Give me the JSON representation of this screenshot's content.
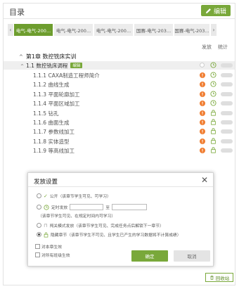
{
  "header": {
    "title": "目录",
    "edit_label": "编辑"
  },
  "tabs": {
    "prev": "‹",
    "next": "›",
    "items": [
      {
        "label": "电气-电气-200...",
        "active": true
      },
      {
        "label": "电气-电气-200...",
        "active": false
      },
      {
        "label": "电气-电气-200...",
        "active": false
      },
      {
        "label": "国赛-电气-203...",
        "active": false
      },
      {
        "label": "国赛-电气-203...",
        "active": false
      }
    ]
  },
  "columns": {
    "publish": "发放",
    "stats": "统计"
  },
  "chapter": {
    "caret": "^",
    "title": "第1章 数控铣床实训"
  },
  "section": {
    "caret": "^",
    "title": "1.1 数控铣床调程",
    "badge": "编辑"
  },
  "rows": [
    {
      "label": "1.1.1 CAXA制造工程师简介",
      "warn": true,
      "status": "clock"
    },
    {
      "label": "1.1.2 曲线生成",
      "warn": true,
      "status": "clock"
    },
    {
      "label": "1.1.3 平面轮廓加工",
      "warn": true,
      "status": "clock"
    },
    {
      "label": "1.1.4 平面区域加工",
      "warn": true,
      "status": "clock"
    },
    {
      "label": "1.1.5 钻孔",
      "warn": true,
      "status": "lock"
    },
    {
      "label": "1.1.6 曲面生成",
      "warn": true,
      "status": "lock"
    },
    {
      "label": "1.1.7 参数线加工",
      "warn": true,
      "status": "lock"
    },
    {
      "label": "1.1.8 实体造型",
      "warn": true,
      "status": "lock"
    },
    {
      "label": "1.1.9 等高线加工",
      "warn": true,
      "status": "lock"
    }
  ],
  "dialog": {
    "title": "发放设置",
    "close": "✕",
    "opt_public": "公开（该章节学生可见、可学习）",
    "opt_timed": "定时发放",
    "opt_timed_to": "至",
    "opt_timed_note": "（该章节学生可见、在规定时间内可学习）",
    "opt_unlock": "闯关模式发放（该章节学生可见、完成任务点后解锁下一章节）",
    "opt_hidden": "隐藏章节（该章节学生不可见、且学生已产生的学习数据将不计算成绩）",
    "chk_sub": "对本章生效",
    "chk_all": "对所有班级生效",
    "ok": "确定",
    "cancel": "取消",
    "selected": "hidden"
  },
  "recycle_label": "回收站",
  "colors": {
    "accent": "#79a83a",
    "active_tab": "#6d9d2e",
    "warn": "#f07c2f"
  }
}
